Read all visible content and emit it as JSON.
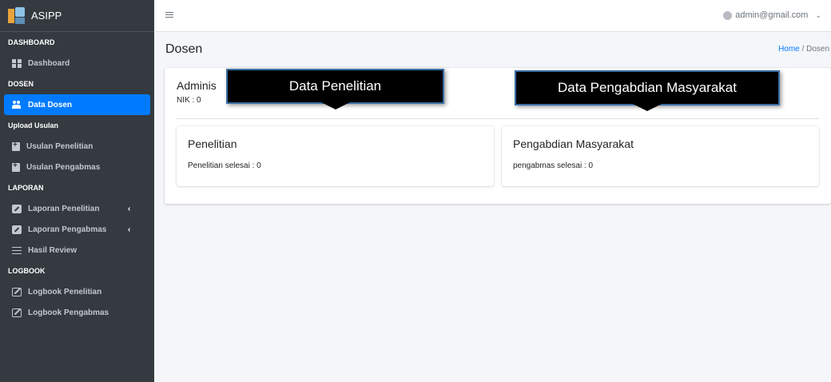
{
  "brand": {
    "name": "ASIPP"
  },
  "sidebar": {
    "headers": {
      "dashboard": "DASHBOARD",
      "dosen": "DOSEN",
      "upload": "Upload Usulan",
      "laporan": "LAPORAN",
      "logbook": "LOGBOOK"
    },
    "items": {
      "dashboard": "Dashboard",
      "data_dosen": "Data Dosen",
      "usulan_penelitian": "Usulan Penelitian",
      "usulan_pengabmas": "Usulan Pengabmas",
      "laporan_penelitian": "Laporan Penelitian",
      "laporan_pengabmas": "Laporan Pengabmas",
      "hasil_review": "Hasil Review",
      "logbook_penelitian": "Logbook Penelitian",
      "logbook_pengabmas": "Logbook Pengabmas"
    },
    "chevron": "‹",
    "active_color": "#007bff"
  },
  "topbar": {
    "menu_icon": "≡",
    "user_email": "admin@gmail.com",
    "caret": "⌄"
  },
  "page": {
    "title": "Dosen",
    "breadcrumb": {
      "home": "Home",
      "separator": "/",
      "current": "Dosen"
    }
  },
  "profile": {
    "name": "Adminis",
    "nik": "NIK : 0"
  },
  "penelitian": {
    "title": "Penelitian",
    "text": "Penelitian selesai : 0"
  },
  "pengabdian": {
    "title": "Pengabdian Masyarakat",
    "text": "pengabmas selesai : 0"
  },
  "callouts": {
    "penelitian": "Data Penelitian",
    "pengabdian": "Data Pengabdian Masyarakat"
  }
}
